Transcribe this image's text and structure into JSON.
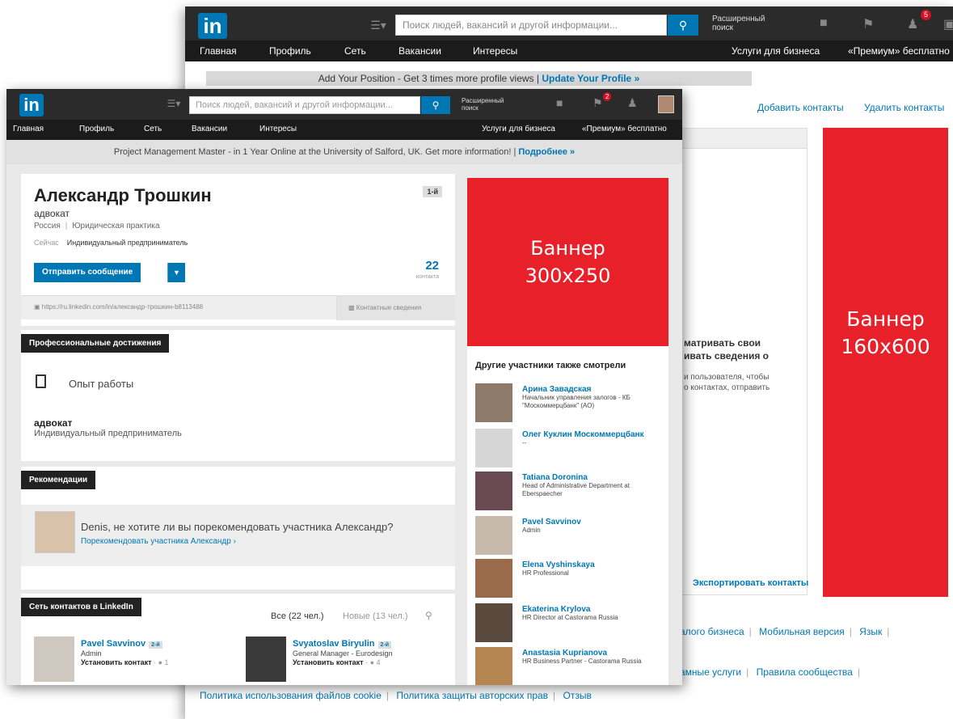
{
  "back": {
    "logo": "in",
    "search_placeholder": "Поиск людей, вакансий и другой информации...",
    "advanced_search": [
      "Расширенный",
      "поиск"
    ],
    "notification_count": "5",
    "nav": [
      "Главная",
      "Профиль",
      "Сеть",
      "Вакансии",
      "Интересы",
      "Услуги для бизнеса",
      "«Премиум» бесплатно"
    ],
    "promo_text": "Add Your Position - Get 3 times more profile views | ",
    "promo_link": "Update Your Profile »",
    "add_contacts": "Добавить контакты",
    "remove_contacts": "Удалить контакты",
    "fragment_bold": [
      "матривать свои",
      "ивать сведения о"
    ],
    "fragment_small": [
      "и пользователя, чтобы",
      "о контактах, отправить"
    ],
    "export_contacts": "Экспортировать контакты",
    "banner": [
      "Баннер",
      "160x600"
    ],
    "footer_row1": [
      "алого бизнеса",
      "Мобильная версия",
      "Язык"
    ],
    "footer_row2": [
      "амные услуги",
      "Правила сообщества"
    ],
    "footer_row3": [
      "Политика использования файлов cookie",
      "Политика защиты авторских прав",
      "Отзыв"
    ]
  },
  "front": {
    "logo": "in",
    "search_placeholder": "Поиск людей, вакансий и другой информации...",
    "advanced_search": [
      "Расширенный",
      "поиск"
    ],
    "notification_count": "2",
    "nav": [
      "Главная",
      "Профиль",
      "Сеть",
      "Вакансии",
      "Интересы",
      "Услуги для бизнеса",
      "«Премиум» бесплатно"
    ],
    "promo_text": "Project Management Master - in 1 Year Online at the University of Salford, UK. Get more information! | ",
    "promo_link": "Подробнее »",
    "profile": {
      "name": "Александр Трошкин",
      "degree": "1-й",
      "title": "адвокат",
      "location": "Россия",
      "industry": "Юридическая практика",
      "current_label": "Сейчас",
      "current_value": "Индивидуальный предприниматель",
      "message_button": "Отправить сообщение",
      "connections": "22",
      "connections_label": "контакта",
      "url": "https://ru.linkedin.com/in/александр-трошкин-b8113488",
      "contact_info": "Контактные сведения"
    },
    "achievements": {
      "heading": "Профессиональные достижения",
      "experience_label": "Опыт работы",
      "job_title": "адвокат",
      "job_org": "Индивидуальный предприниматель"
    },
    "recommendations": {
      "heading": "Рекомендации",
      "question": "Denis, не хотите ли вы порекомендовать участника Александр?",
      "link": "Порекомендовать участника Александр ›"
    },
    "network": {
      "heading": "Сеть контактов в LinkedIn",
      "all": "Все (22 чел.)",
      "new": "Новые (13 чел.)",
      "people": [
        {
          "name": "Pavel Savvinov",
          "degree": "2-й",
          "title": "Admin",
          "action": "Установить контакт",
          "shared": "1"
        },
        {
          "name": "Svyatoslav Biryulin",
          "degree": "2-й",
          "title": "General Manager - Eurodesign",
          "action": "Установить контакт",
          "shared": "4"
        }
      ]
    },
    "banner": [
      "Баннер",
      "300x250"
    ],
    "also_viewed": {
      "heading": "Другие участники также смотрели",
      "people": [
        {
          "name": "Арина Завадская",
          "title": "Начальник управления залогов - КБ \"Москоммерцбанк\" (АО)"
        },
        {
          "name": "Олег Куклин Москоммерцбанк",
          "title": "--"
        },
        {
          "name": "Tatiana Doronina",
          "title": "Head of Administrative Department at Eberspaecher"
        },
        {
          "name": "Pavel Savvinov",
          "title": "Admin"
        },
        {
          "name": "Elena Vyshinskaya",
          "title": "HR Professional"
        },
        {
          "name": "Ekaterina Krylova",
          "title": "HR Director at Castorama Russia"
        },
        {
          "name": "Anastasia Kuprianova",
          "title": "HR Business Partner - Castorama Russia"
        }
      ]
    }
  },
  "colors": {
    "linkedin_blue": "#0077b5",
    "banner_red": "#e8202a",
    "topbar": "#2b2b2b"
  }
}
